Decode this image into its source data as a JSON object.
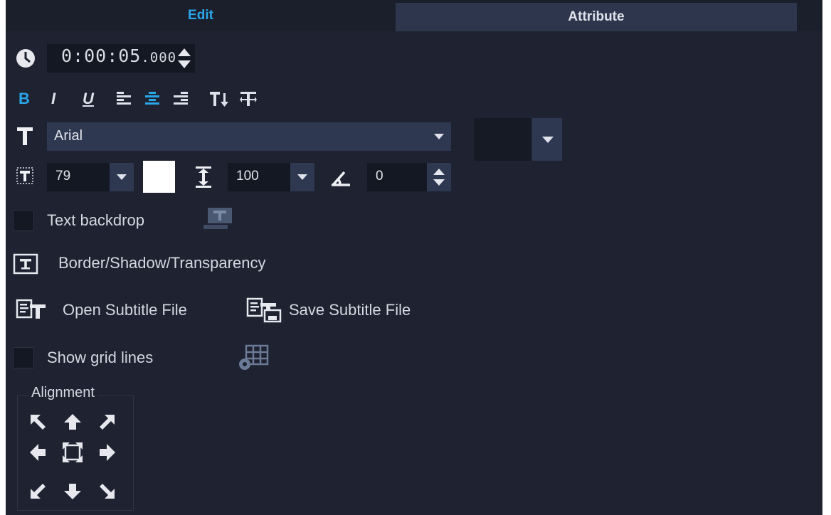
{
  "tabs": [
    {
      "label": "Edit",
      "active": true
    },
    {
      "label": "Attribute",
      "active": false
    }
  ],
  "duration": {
    "main": "0:00:05",
    "ms": ".000"
  },
  "toolbar": {
    "bold": "B",
    "italic": "I",
    "underline": "U",
    "items": [
      "bold",
      "italic",
      "underline",
      "align-left",
      "align-center",
      "align-right",
      "text-vertical",
      "text-direction"
    ],
    "active_color": "#2aa6ea"
  },
  "font": {
    "value": "Arial"
  },
  "font_size": {
    "value": "79"
  },
  "line_spacing": {
    "value": "100"
  },
  "rotation": {
    "value": "0"
  },
  "text_color": "#ffffff",
  "options": {
    "text_backdrop": "Text backdrop",
    "border_shadow": "Border/Shadow/Transparency",
    "open_subtitle": "Open Subtitle File",
    "save_subtitle": "Save Subtitle File",
    "show_grid": "Show grid lines"
  },
  "alignment": {
    "title": "Alignment"
  }
}
